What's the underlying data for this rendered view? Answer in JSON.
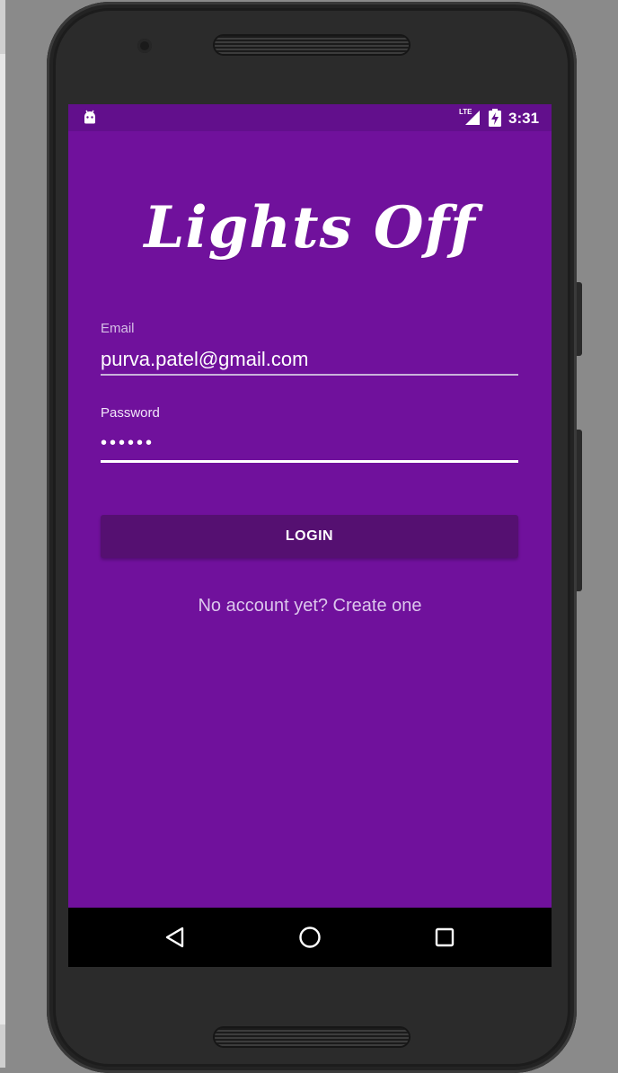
{
  "status_bar": {
    "time": "3:31",
    "network": "LTE"
  },
  "app": {
    "logo_text": "Lights Off",
    "email": {
      "label": "Email",
      "value": "purva.patel@gmail.com"
    },
    "password": {
      "label": "Password",
      "value": "••••••"
    },
    "login_button": "LOGIN",
    "signup_link": "No account yet? Create one"
  },
  "colors": {
    "app_background": "#70119c",
    "status_bar": "#620f8c",
    "login_button": "#551071",
    "nav_bar": "#000000"
  },
  "icons": {
    "status_left": "android-icon",
    "status_right": [
      "lte-signal-icon",
      "battery-charging-icon"
    ],
    "nav": [
      "back-icon",
      "home-icon",
      "recent-apps-icon"
    ]
  }
}
